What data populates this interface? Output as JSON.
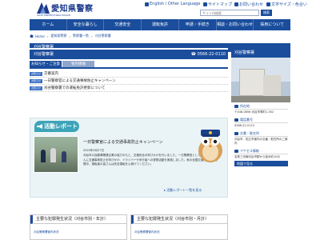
{
  "header": {
    "logo_text": "愛知県警察",
    "logo_sub": "AICHI PREFECTURAL POLICE",
    "util_links": [
      "English / Other Language",
      "サイトマップ",
      "お問い合わせ",
      "文字サイズ・色合い"
    ],
    "search_placeholder": "サイト内検索",
    "search_button": "検索"
  },
  "gnav": [
    "ホーム",
    "安全な暮らし",
    "交通安全",
    "運転免許",
    "申請・手続き",
    "相談・お問い合わせ",
    "採用について"
  ],
  "breadcrumb": [
    "Home",
    "愛知県警察",
    "警察署一覧",
    "刈谷警察署"
  ],
  "station": {
    "name": "刈谷警察署",
    "tel": "☎ 0566-22-0110"
  },
  "tabs": [
    {
      "label": "お知らせ・ご注意",
      "active": true
    },
    {
      "label": "管内情報",
      "active": false
    }
  ],
  "notices": [
    {
      "badge": "お知らせ",
      "text": "交番案内"
    },
    {
      "badge": "お知らせ",
      "text": "一日警察官による交通事故防止キャンペーン"
    },
    {
      "badge": "お知らせ",
      "text": "刈谷警察署での運転免許更新について"
    }
  ],
  "activity": {
    "banner": "活動レポート",
    "title": "一日警察官による交通事故防止キャンペーン",
    "date": "2022年9月27日",
    "body": "刈谷市の自動車関連企業の協力のもと、交通安全の呼びかけを行いました。一日警察官として、地域の皆さんに交通事故防止を呼びかけ、ドライバーや歩行者への啓発活動を実施しました。秋の全国交通安全運動期間中、運転者の皆さんは安全運転を心掛けてください。",
    "more": "活動レポート一覧を見る"
  },
  "sidebar": {
    "title": "刈谷警察署",
    "address_label": "所在地",
    "address": "〒448-0856 刈谷市寿町1-302",
    "tel_label": "電話番号",
    "tel": "0566-22-0110",
    "area_label": "交番・駐在所",
    "area_text": "刈谷市、知立市管内の交番・駐在所のご案内",
    "access_label": "アクセス情報",
    "access_text": "名鉄三河線刈谷市駅から徒歩約10分",
    "map_link": "地図で見る"
  },
  "stats": [
    {
      "title": "主要な犯罪発生状況（刈谷市別・年計）",
      "link": "刈谷警察署管内状況"
    },
    {
      "title": "主要な犯罪発生状況（刈谷市別・月計）",
      "link": "刈谷警察署管内状況"
    }
  ],
  "colors": {
    "primary": "#1a4d9c",
    "tab_inactive": "#8fa6cc",
    "activity_bg": "#eaf4f6",
    "activity_accent": "#3da4b8"
  }
}
